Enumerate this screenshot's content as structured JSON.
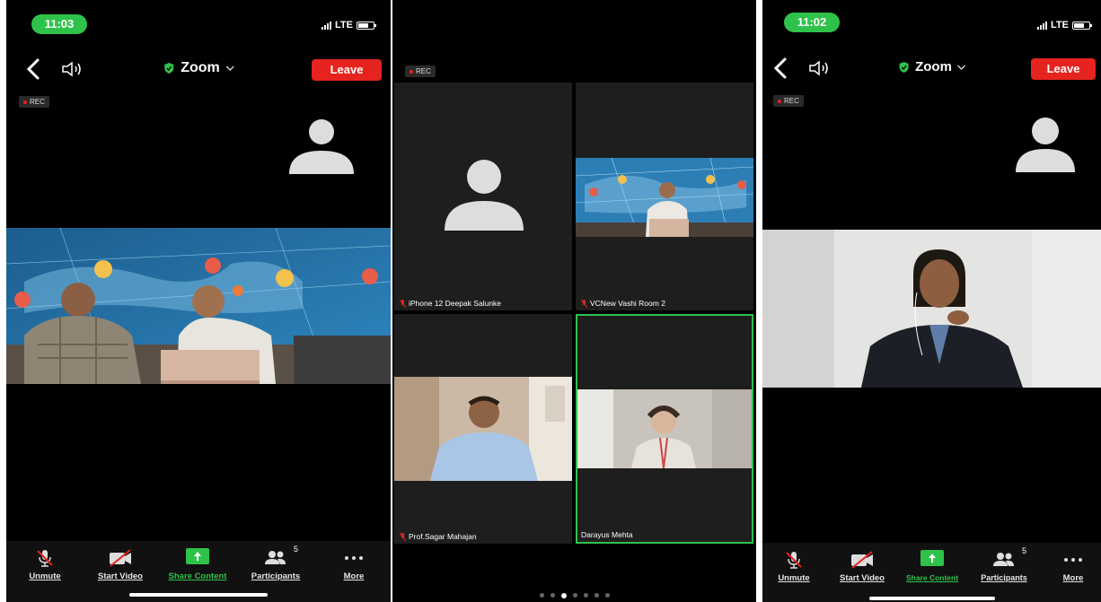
{
  "screens": {
    "left": {
      "time": "11:03",
      "network": "LTE",
      "meeting_title": "Zoom",
      "leave_label": "Leave",
      "rec_label": "REC",
      "toolbar": {
        "unmute": "Unmute",
        "start_video": "Start Video",
        "share_content": "Share Content",
        "participants": "Participants",
        "participants_count": "5",
        "more": "More"
      }
    },
    "middle": {
      "rec_label": "REC",
      "tiles": [
        {
          "name": "iPhone 12 Deepak Salunke"
        },
        {
          "name": "VCNew Vashi Room 2"
        },
        {
          "name": "Prof.Sagar Mahajan"
        },
        {
          "name": "Darayus Mehta"
        }
      ]
    },
    "right": {
      "time": "11:02",
      "network": "LTE",
      "meeting_title": "Zoom",
      "leave_label": "Leave",
      "rec_label": "REC",
      "toolbar": {
        "unmute": "Unmute",
        "start_video": "Start Video",
        "share_content": "Share Content",
        "participants": "Participants",
        "participants_count": "5",
        "more": "More"
      }
    }
  },
  "colors": {
    "accent_green": "#2fc24a",
    "leave_red": "#e5231f",
    "background": "#000000"
  },
  "icons": [
    "back-icon",
    "speaker-icon",
    "shield-icon",
    "chevron-down-icon",
    "mic-off-icon",
    "video-off-icon",
    "share-icon",
    "participants-icon",
    "more-icon",
    "avatar-icon"
  ]
}
